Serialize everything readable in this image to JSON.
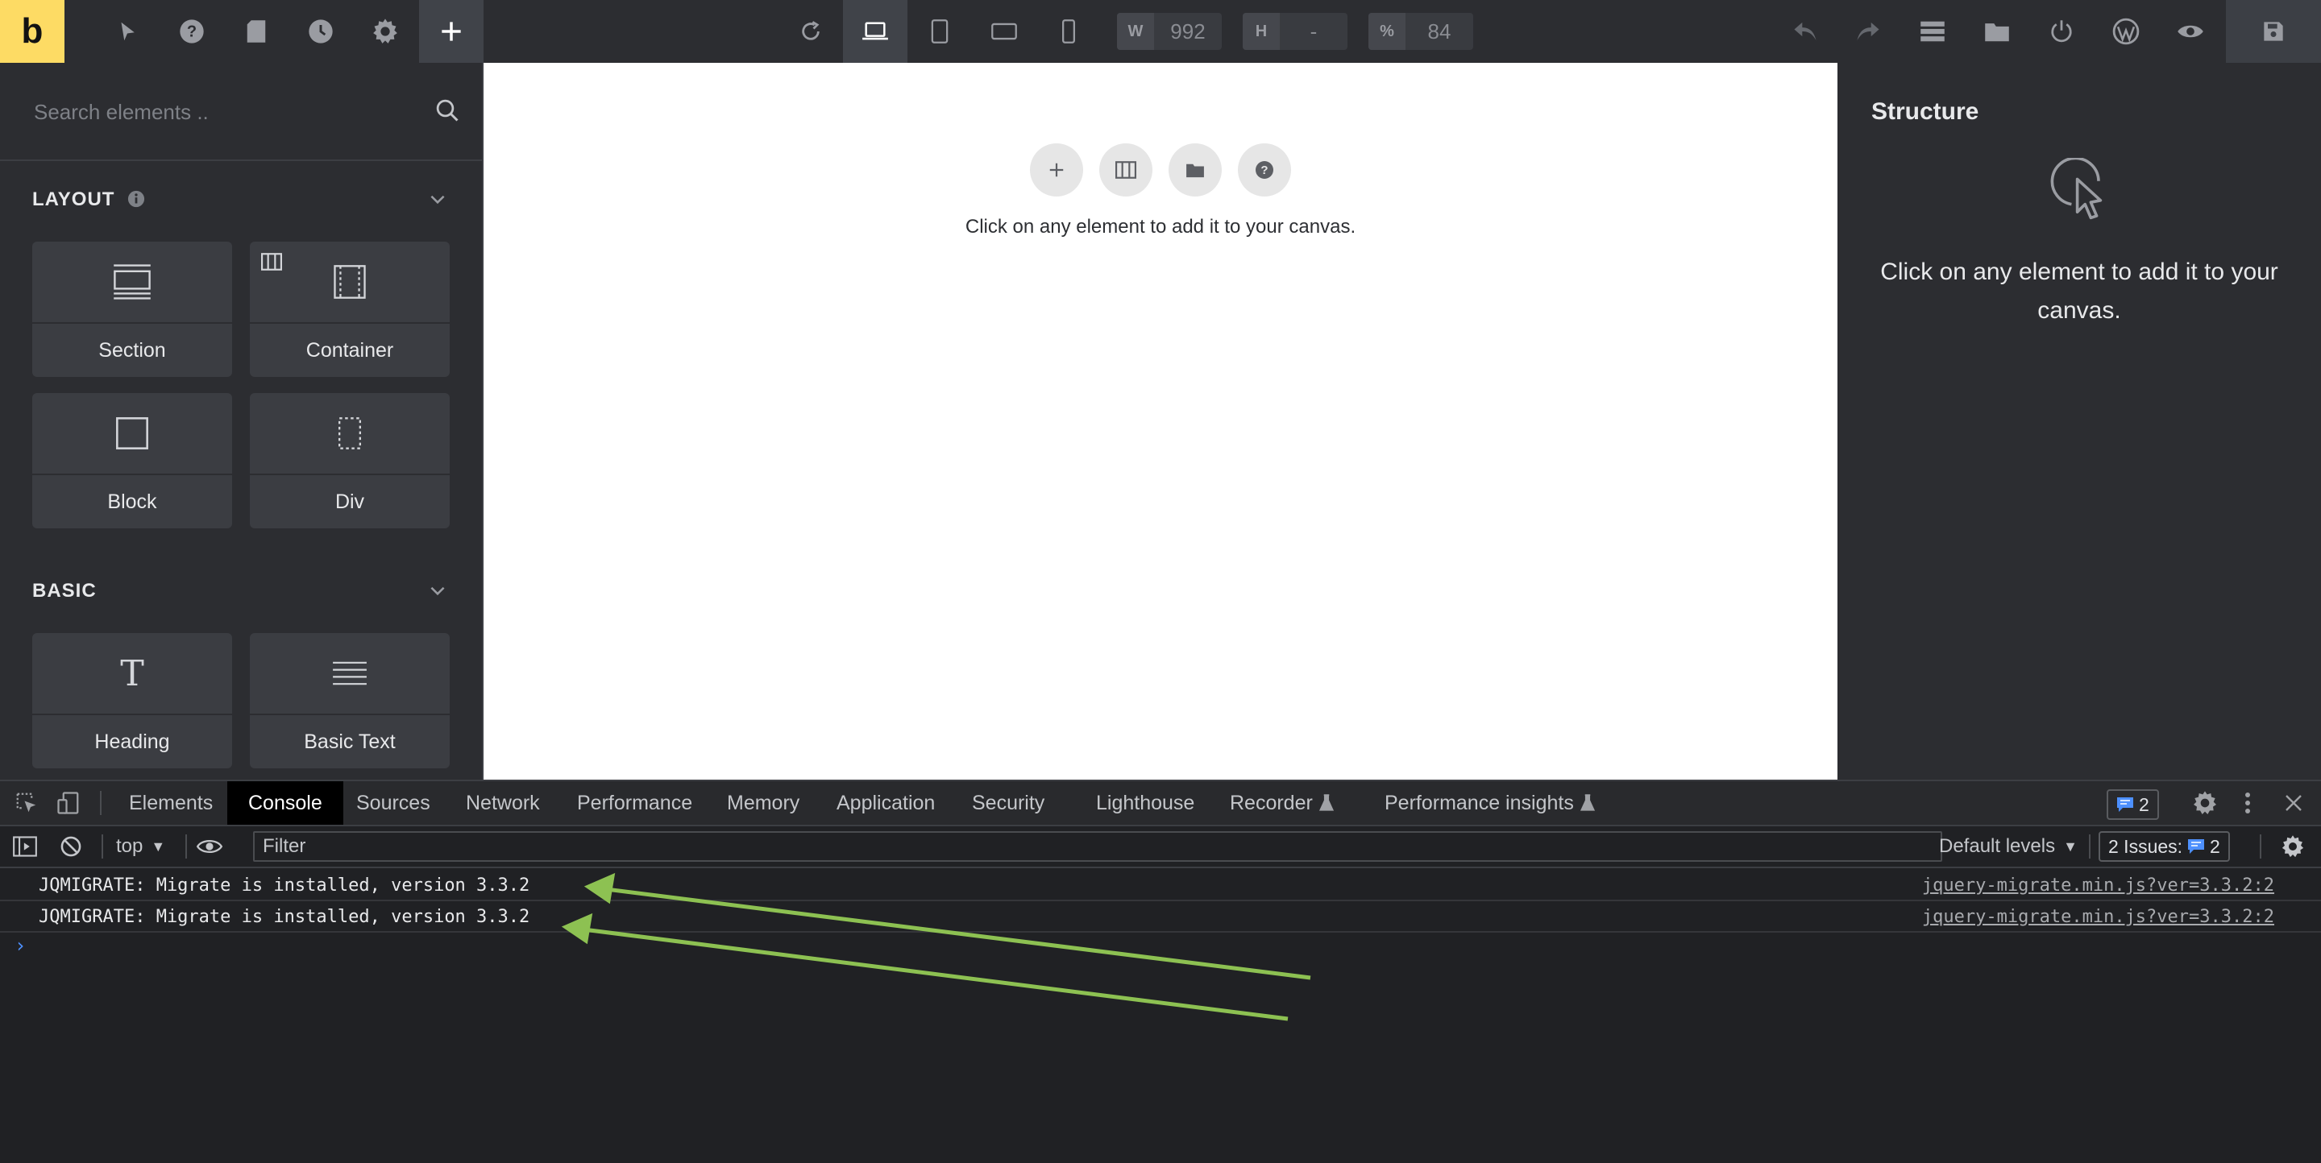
{
  "app": {
    "logo": "b"
  },
  "toolbar": {
    "left_icons": [
      "cursor-icon",
      "help-icon",
      "page-icon",
      "history-icon",
      "settings-icon",
      "add-icon"
    ],
    "device_icons": [
      "refresh-icon",
      "laptop-icon",
      "tablet-portrait-icon",
      "tablet-landscape-icon",
      "mobile-icon"
    ],
    "width": {
      "label": "W",
      "value": "992"
    },
    "height": {
      "label": "H",
      "value": "-"
    },
    "zoom": {
      "label": "%",
      "value": "84"
    },
    "right_icons": [
      "undo-icon",
      "redo-icon",
      "stack-icon",
      "folder-icon",
      "power-icon",
      "wordpress-icon",
      "preview-icon",
      "save-icon"
    ]
  },
  "sidebar": {
    "search_placeholder": "Search elements ..",
    "categories": [
      {
        "title": "LAYOUT",
        "items": [
          {
            "label": "Section",
            "icon": "section-icon"
          },
          {
            "label": "Container",
            "icon": "container-icon"
          },
          {
            "label": "Block",
            "icon": "block-icon"
          },
          {
            "label": "Div",
            "icon": "div-icon"
          }
        ]
      },
      {
        "title": "BASIC",
        "items": [
          {
            "label": "Heading",
            "icon": "heading-icon"
          },
          {
            "label": "Basic Text",
            "icon": "basic-text-icon"
          }
        ]
      }
    ]
  },
  "canvas": {
    "buttons": [
      "add-icon",
      "columns-icon",
      "folder-icon",
      "help-icon"
    ],
    "hint": "Click on any element to add it to your canvas."
  },
  "structure": {
    "title": "Structure",
    "hint": "Click on any element to add it to your canvas."
  },
  "devtools": {
    "tabs": [
      "Elements",
      "Console",
      "Sources",
      "Network",
      "Performance",
      "Memory",
      "Application",
      "Security",
      "Lighthouse",
      "Recorder",
      "Performance insights"
    ],
    "active_tab": "Console",
    "messages_count": "2",
    "context": "top",
    "filter_placeholder": "Filter",
    "levels": "Default levels",
    "issues_label": "2 Issues:",
    "issues_count": "2",
    "logs": [
      {
        "message": "JQMIGRATE: Migrate is installed, version 3.3.2",
        "source": "jquery-migrate.min.js?ver=3.3.2:2"
      },
      {
        "message": "JQMIGRATE: Migrate is installed, version 3.3.2",
        "source": "jquery-migrate.min.js?ver=3.3.2:2"
      }
    ],
    "prompt": "›"
  },
  "colors": {
    "accent": "#fddb64",
    "annotation_arrow": "#8dc152",
    "link_blue": "#4d90fe"
  }
}
